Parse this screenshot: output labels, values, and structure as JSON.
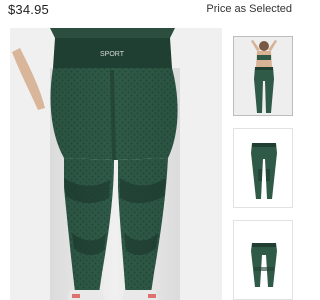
{
  "product": {
    "price": "$34.95",
    "price_selected_label": "Price as Selected",
    "waistband_logo": "SPORT",
    "color_hex": "#2f5a47",
    "color_dark_hex": "#1f3f32"
  },
  "gallery": {
    "hero_icon": "leggings-back-view-photo",
    "thumbnails": [
      {
        "icon": "model-back-view-photo",
        "selected": true
      },
      {
        "icon": "leggings-flat-lay-photo",
        "selected": false
      },
      {
        "icon": "leggings-folded-photo",
        "selected": false
      }
    ]
  }
}
